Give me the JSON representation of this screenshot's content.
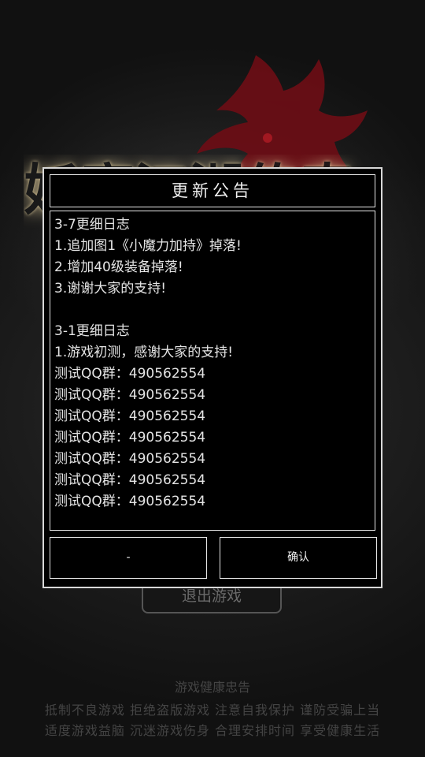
{
  "background": {
    "exit_button_label": "退出游戏",
    "advice": {
      "title": "游戏健康忠告",
      "line1": "抵制不良游戏  拒绝盗版游戏  注意自我保护  谨防受骗上当",
      "line2": "适度游戏益脑  沉迷游戏伤身  合理安排时间  享受健康生活"
    },
    "colors": {
      "dragon": "#7a0f18",
      "title_glow": "#e6d2a0"
    }
  },
  "dialog": {
    "title": "更新公告",
    "lines": [
      "3-7更细日志",
      "1.追加图1《小魔力加持》掉落!",
      "2.增加40级装备掉落!",
      "3.谢谢大家的支持!",
      "",
      "3-1更细日志",
      "1.游戏初测，感谢大家的支持!",
      "测试QQ群：490562554",
      "测试QQ群：490562554",
      "测试QQ群：490562554",
      "测试QQ群：490562554",
      "测试QQ群：490562554",
      "测试QQ群：490562554",
      "测试QQ群：490562554"
    ],
    "left_button_label": "-",
    "right_button_label": "确认"
  }
}
